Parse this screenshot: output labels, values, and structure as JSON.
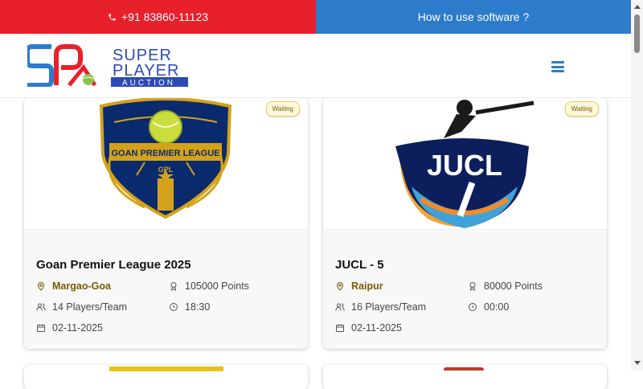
{
  "topbar": {
    "phone": "+91 83860-11123",
    "howto": "How to use software ?"
  },
  "logo": {
    "line1": "SUPER",
    "line2": "PLAYER",
    "line3": "AUCTION"
  },
  "colors": {
    "red": "#e8202a",
    "blue": "#2d7ccb",
    "gold": "#7a5a00"
  },
  "cards": [
    {
      "badge": "Waiting",
      "logo_text": "GOAN PREMIER LEAGUE",
      "logo_sub": "GPL",
      "title": "Goan Premier League 2025",
      "location": "Margao-Goa",
      "points": "105000 Points",
      "players": "14 Players/Team",
      "time": "18:30",
      "date": "02-11-2025"
    },
    {
      "badge": "Waiting",
      "logo_text": "JUCL",
      "title": "JUCL - 5",
      "location": "Raipur",
      "points": "80000 Points",
      "players": "16 Players/Team",
      "time": "00:00",
      "date": "02-11-2025"
    }
  ]
}
